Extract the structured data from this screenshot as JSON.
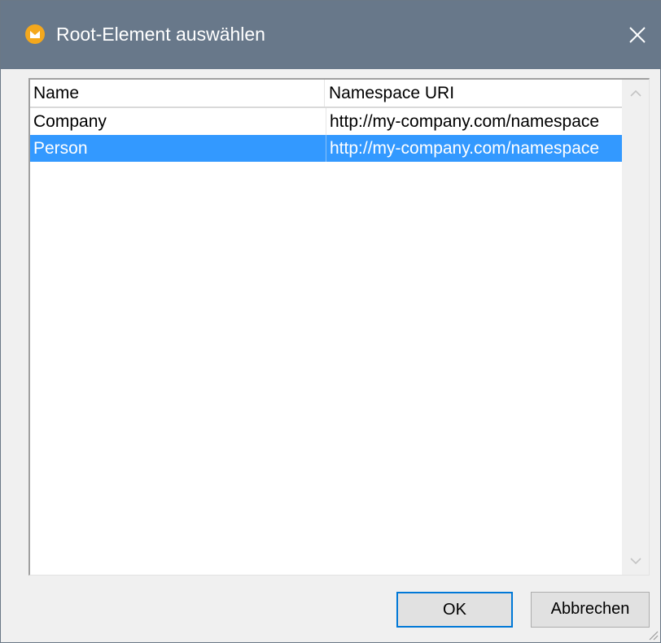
{
  "window": {
    "title": "Root-Element auswählen",
    "app_icon": "altova-mapforce-icon",
    "close_icon": "close-icon"
  },
  "table": {
    "columns": [
      "Name",
      "Namespace URI"
    ],
    "rows": [
      {
        "name": "Company",
        "namespace": "http://my-company.com/namespace",
        "selected": false
      },
      {
        "name": "Person",
        "namespace": "http://my-company.com/namespace",
        "selected": true
      }
    ]
  },
  "scrollbar": {
    "up_icon": "chevron-up-icon",
    "down_icon": "chevron-down-icon"
  },
  "buttons": {
    "ok_label": "OK",
    "cancel_label": "Abbrechen"
  },
  "colors": {
    "titlebar": "#68788a",
    "selection": "#3399ff",
    "default_button_border": "#0078d7",
    "app_icon": "#f4a81d"
  }
}
